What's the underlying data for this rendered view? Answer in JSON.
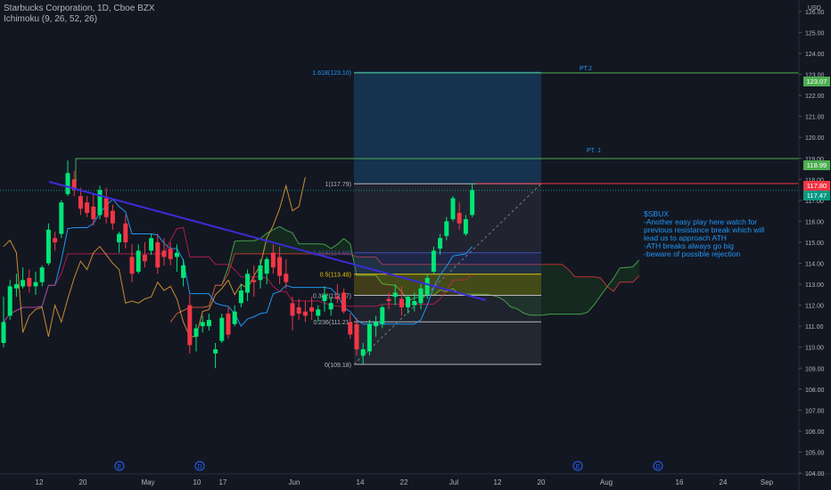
{
  "header": {
    "title": "Starbucks Corporation, 1D, Cboe BZX",
    "indicator": "Ichimoku (9, 26, 52, 26)"
  },
  "y_axis": {
    "unit": "USD",
    "ticks": [
      "126.00",
      "125.00",
      "124.00",
      "123.00",
      "122.00",
      "121.00",
      "120.00",
      "119.00",
      "118.00",
      "117.00",
      "116.00",
      "115.00",
      "114.00",
      "113.00",
      "112.00",
      "111.00",
      "110.00",
      "109.00",
      "108.00",
      "107.00",
      "106.00",
      "105.00",
      "104.00"
    ]
  },
  "x_axis": {
    "ticks": [
      "12",
      "20",
      "May",
      "10",
      "17",
      "Jun",
      "14",
      "22",
      "Jul",
      "12",
      "20",
      "Aug",
      "16",
      "24",
      "Sep"
    ]
  },
  "price_tags": [
    {
      "value": "123.07",
      "color": "#4caf50"
    },
    {
      "value": "118.99",
      "color": "#4caf50"
    },
    {
      "value": "117.80",
      "color": "#f23645"
    },
    {
      "value": "117.47",
      "color": "#089981"
    }
  ],
  "fib_levels": [
    {
      "label": "1.618(123.10)",
      "color": "#2196f3"
    },
    {
      "label": "1(117.79)",
      "color": "#b2b5be"
    },
    {
      "label": "0.618(114.50)",
      "color": "#3f51b5"
    },
    {
      "label": "0.5(113.48)",
      "color": "#e6c200"
    },
    {
      "label": "0.382(112.47)",
      "color": "#b2b5be"
    },
    {
      "label": "0.236(111.21)",
      "color": "#b2b5be"
    },
    {
      "label": "0(109.18)",
      "color": "#b2b5be"
    }
  ],
  "targets": [
    "PT.2",
    "PT. 1"
  ],
  "event_markers": [
    "E",
    "D",
    "E",
    "D"
  ],
  "note": {
    "lines": [
      "$SBUX",
      "-Another easy play here watch for",
      "previous resistance break which will",
      "lead us to approach ATH",
      "-ATH breaks always go big",
      "-beware of possible rejection"
    ]
  },
  "colors": {
    "up": "#00e676",
    "down": "#f23645",
    "background": "#131722",
    "conversion": "#2196f3",
    "base": "#e91e63",
    "lagging": "#f7a934",
    "trendline": "#3d2bd8",
    "target": "#4caf50"
  },
  "chart_data": {
    "type": "candlestick",
    "title": "Starbucks Corporation, 1D, Cboe BZX",
    "y_range": [
      104,
      126.5
    ],
    "candles": [
      {
        "o": 110.2,
        "h": 112.4,
        "l": 110.0,
        "c": 111.2
      },
      {
        "o": 111.5,
        "h": 113.2,
        "l": 111.3,
        "c": 112.9
      },
      {
        "o": 112.8,
        "h": 113.5,
        "l": 112.4,
        "c": 113.0
      },
      {
        "o": 112.9,
        "h": 113.8,
        "l": 112.8,
        "c": 113.2
      },
      {
        "o": 113.3,
        "h": 113.7,
        "l": 112.6,
        "c": 112.9
      },
      {
        "o": 112.9,
        "h": 113.6,
        "l": 112.5,
        "c": 113.1
      },
      {
        "o": 113.1,
        "h": 113.9,
        "l": 112.9,
        "c": 113.8
      },
      {
        "o": 114.0,
        "h": 115.9,
        "l": 113.9,
        "c": 115.6
      },
      {
        "o": 115.2,
        "h": 115.5,
        "l": 114.6,
        "c": 115.0
      },
      {
        "o": 115.4,
        "h": 117.0,
        "l": 115.2,
        "c": 116.9
      },
      {
        "o": 117.3,
        "h": 118.9,
        "l": 117.2,
        "c": 118.3
      },
      {
        "o": 118.0,
        "h": 118.4,
        "l": 117.2,
        "c": 117.5
      },
      {
        "o": 117.2,
        "h": 117.6,
        "l": 116.3,
        "c": 116.6
      },
      {
        "o": 116.9,
        "h": 117.2,
        "l": 116.2,
        "c": 116.4
      },
      {
        "o": 116.7,
        "h": 117.3,
        "l": 115.8,
        "c": 116.1
      },
      {
        "o": 116.3,
        "h": 117.7,
        "l": 116.1,
        "c": 117.5
      },
      {
        "o": 117.1,
        "h": 117.6,
        "l": 115.9,
        "c": 116.2
      },
      {
        "o": 116.5,
        "h": 116.8,
        "l": 115.6,
        "c": 115.9
      },
      {
        "o": 115.0,
        "h": 115.5,
        "l": 114.5,
        "c": 115.4
      },
      {
        "o": 115.9,
        "h": 116.3,
        "l": 114.7,
        "c": 115.0
      },
      {
        "o": 114.3,
        "h": 114.9,
        "l": 113.1,
        "c": 113.5
      },
      {
        "o": 113.6,
        "h": 114.9,
        "l": 113.5,
        "c": 114.6
      },
      {
        "o": 114.4,
        "h": 115.0,
        "l": 113.8,
        "c": 114.1
      },
      {
        "o": 114.6,
        "h": 115.4,
        "l": 114.4,
        "c": 115.2
      },
      {
        "o": 115.0,
        "h": 115.4,
        "l": 113.5,
        "c": 113.8
      },
      {
        "o": 114.6,
        "h": 115.2,
        "l": 113.9,
        "c": 114.3
      },
      {
        "o": 114.7,
        "h": 115.0,
        "l": 113.9,
        "c": 114.2
      },
      {
        "o": 114.3,
        "h": 114.9,
        "l": 113.6,
        "c": 114.5
      },
      {
        "o": 113.3,
        "h": 114.2,
        "l": 112.9,
        "c": 113.9
      },
      {
        "o": 112.0,
        "h": 112.5,
        "l": 109.7,
        "c": 110.1
      },
      {
        "o": 110.5,
        "h": 111.1,
        "l": 109.8,
        "c": 110.9
      },
      {
        "o": 111.0,
        "h": 111.5,
        "l": 110.7,
        "c": 111.2
      },
      {
        "o": 111.0,
        "h": 111.6,
        "l": 110.8,
        "c": 111.3
      },
      {
        "o": 109.7,
        "h": 110.2,
        "l": 109.0,
        "c": 109.9
      },
      {
        "o": 110.3,
        "h": 111.6,
        "l": 110.2,
        "c": 111.4
      },
      {
        "o": 111.6,
        "h": 111.9,
        "l": 110.4,
        "c": 110.6
      },
      {
        "o": 111.1,
        "h": 112.0,
        "l": 111.0,
        "c": 111.7
      },
      {
        "o": 112.1,
        "h": 113.0,
        "l": 111.9,
        "c": 112.7
      },
      {
        "o": 112.6,
        "h": 113.7,
        "l": 112.2,
        "c": 113.5
      },
      {
        "o": 113.2,
        "h": 113.9,
        "l": 112.4,
        "c": 113.1
      },
      {
        "o": 113.2,
        "h": 114.2,
        "l": 112.8,
        "c": 113.9
      },
      {
        "o": 113.5,
        "h": 114.3,
        "l": 113.0,
        "c": 114.2
      },
      {
        "o": 114.5,
        "h": 114.9,
        "l": 113.5,
        "c": 113.8
      },
      {
        "o": 114.3,
        "h": 114.8,
        "l": 113.0,
        "c": 113.4
      },
      {
        "o": 113.5,
        "h": 114.2,
        "l": 112.8,
        "c": 113.1
      },
      {
        "o": 112.1,
        "h": 112.4,
        "l": 110.8,
        "c": 111.5
      },
      {
        "o": 111.9,
        "h": 112.3,
        "l": 111.3,
        "c": 111.6
      },
      {
        "o": 111.7,
        "h": 112.2,
        "l": 111.2,
        "c": 111.5
      },
      {
        "o": 111.9,
        "h": 112.4,
        "l": 111.3,
        "c": 111.7
      },
      {
        "o": 111.5,
        "h": 112.0,
        "l": 111.2,
        "c": 111.8
      },
      {
        "o": 112.2,
        "h": 112.9,
        "l": 111.7,
        "c": 112.5
      },
      {
        "o": 111.8,
        "h": 112.4,
        "l": 111.5,
        "c": 112.1
      },
      {
        "o": 112.4,
        "h": 113.0,
        "l": 112.1,
        "c": 112.3
      },
      {
        "o": 112.6,
        "h": 112.8,
        "l": 111.6,
        "c": 111.7
      },
      {
        "o": 111.2,
        "h": 111.6,
        "l": 110.4,
        "c": 110.6
      },
      {
        "o": 111.1,
        "h": 111.4,
        "l": 109.6,
        "c": 109.9
      },
      {
        "o": 109.6,
        "h": 110.2,
        "l": 109.2,
        "c": 109.9
      },
      {
        "o": 109.8,
        "h": 111.3,
        "l": 109.6,
        "c": 111.1
      },
      {
        "o": 111.0,
        "h": 111.5,
        "l": 110.5,
        "c": 111.2
      },
      {
        "o": 111.1,
        "h": 112.0,
        "l": 110.9,
        "c": 111.9
      },
      {
        "o": 112.3,
        "h": 112.6,
        "l": 111.8,
        "c": 112.2
      },
      {
        "o": 112.4,
        "h": 113.0,
        "l": 112.0,
        "c": 112.6
      },
      {
        "o": 112.3,
        "h": 112.9,
        "l": 111.5,
        "c": 111.9
      },
      {
        "o": 111.9,
        "h": 112.5,
        "l": 111.6,
        "c": 112.4
      },
      {
        "o": 112.0,
        "h": 112.6,
        "l": 111.7,
        "c": 112.2
      },
      {
        "o": 112.1,
        "h": 113.0,
        "l": 111.8,
        "c": 112.8
      },
      {
        "o": 112.5,
        "h": 113.5,
        "l": 112.3,
        "c": 113.3
      },
      {
        "o": 113.6,
        "h": 114.8,
        "l": 113.5,
        "c": 114.6
      },
      {
        "o": 114.7,
        "h": 115.4,
        "l": 114.4,
        "c": 115.2
      },
      {
        "o": 115.3,
        "h": 116.2,
        "l": 115.1,
        "c": 116.0
      },
      {
        "o": 116.1,
        "h": 117.2,
        "l": 116.0,
        "c": 117.1
      },
      {
        "o": 116.4,
        "h": 116.9,
        "l": 115.6,
        "c": 115.9
      },
      {
        "o": 115.4,
        "h": 116.3,
        "l": 115.3,
        "c": 116.1
      },
      {
        "o": 116.3,
        "h": 117.8,
        "l": 116.2,
        "c": 117.5
      }
    ]
  }
}
